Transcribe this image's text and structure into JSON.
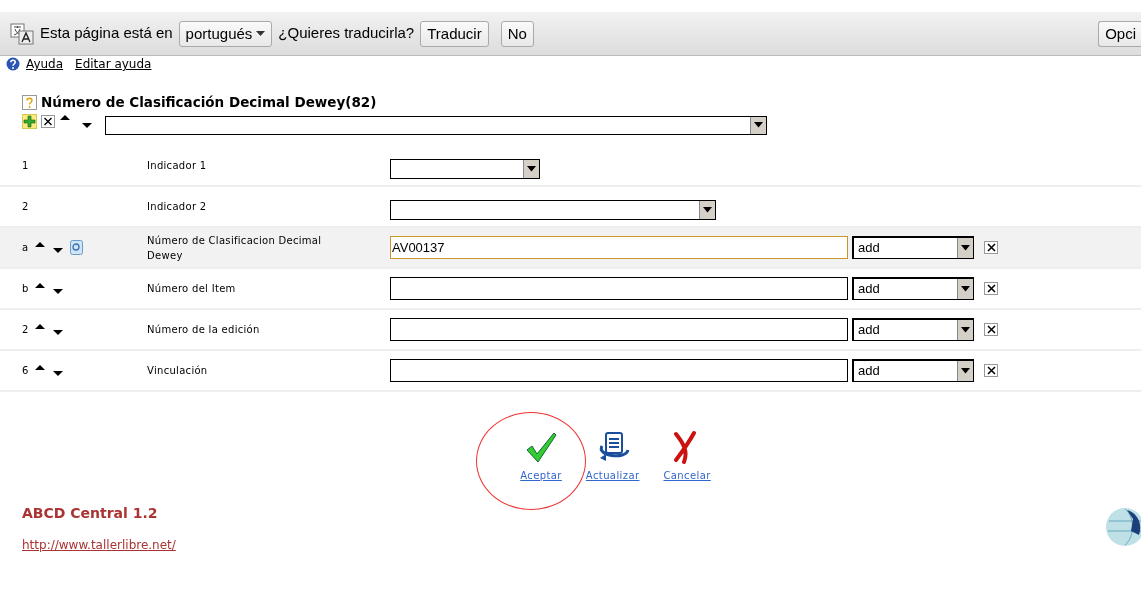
{
  "translate_bar": {
    "text": "Esta página está en",
    "language": "portugués",
    "question": "¿Quieres traducirla?",
    "buttons": [
      "Traducir",
      "No"
    ],
    "options_button": "Opci"
  },
  "help_links": [
    "Ayuda",
    "Editar ayuda"
  ],
  "field": {
    "title": "Número de Clasificación Decimal Dewey(82)"
  },
  "rows": [
    {
      "kind": "indicator",
      "code": "1",
      "label": "Indicador 1",
      "highlighted": false
    },
    {
      "kind": "indicator",
      "code": "2",
      "label": "Indicador 2",
      "highlighted": false
    },
    {
      "kind": "subfield",
      "code": "a",
      "label": "Número de Clasificacion Decimal Dewey",
      "value": "AV00137",
      "action": "add",
      "lookup": true,
      "highlighted": true
    },
    {
      "kind": "subfield",
      "code": "b",
      "label": "Número del Item",
      "action": "add",
      "lookup": false,
      "highlighted": false
    },
    {
      "kind": "subfield",
      "code": "2",
      "label": "Número de la edición",
      "action": "add",
      "lookup": false,
      "highlighted": false
    },
    {
      "kind": "subfield",
      "code": "6",
      "label": "Vinculación",
      "action": "add",
      "lookup": false,
      "highlighted": false
    }
  ],
  "actions": [
    {
      "kind": "accept",
      "label": "Aceptar",
      "circled": true
    },
    {
      "kind": "refresh",
      "label": "Actualizar",
      "circled": false
    },
    {
      "kind": "cancel",
      "label": "Cancelar",
      "circled": false
    }
  ],
  "footer": {
    "title": "ABCD Central 1.2",
    "link": "http://www.tallerlibre.net/"
  }
}
